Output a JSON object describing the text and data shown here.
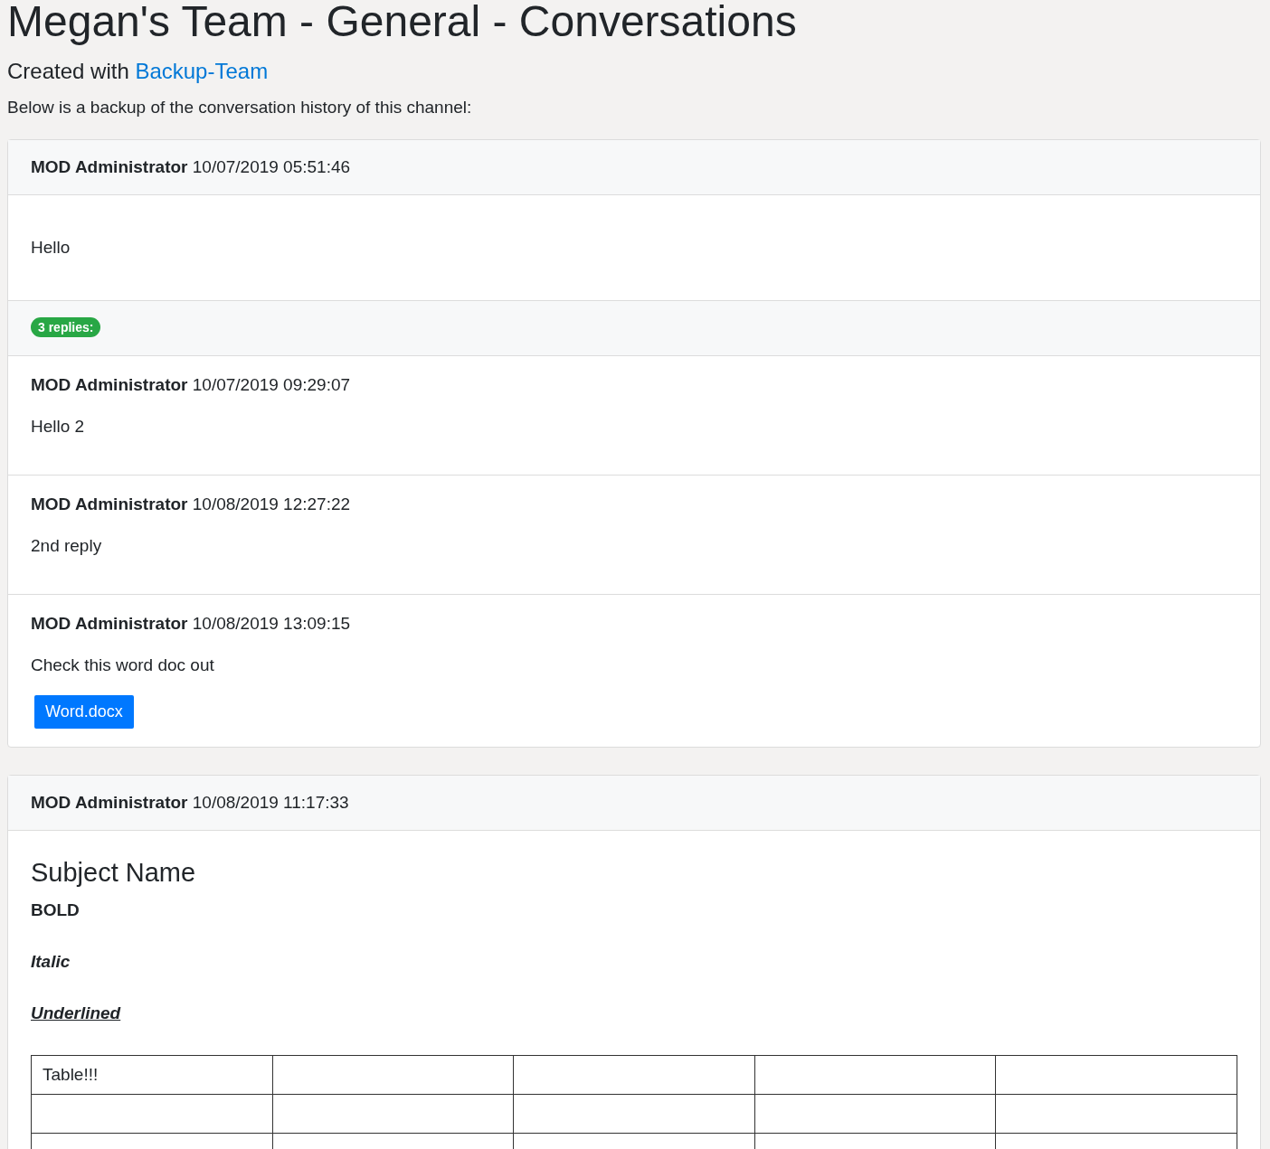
{
  "page": {
    "title": "Megan's Team - General - Conversations",
    "subtitle": "Created with",
    "subtitle_link": "Backup-Team",
    "intro": "Below is a backup of the conversation history of this channel:"
  },
  "threads": [
    {
      "author": "MOD Administrator",
      "time": "10/07/2019 05:51:46",
      "blocks": [
        {
          "kind": "text",
          "text": "Hello"
        }
      ],
      "replies_badge": "3 replies:",
      "replies": [
        {
          "author": "MOD Administrator",
          "time": "10/07/2019 09:29:07",
          "text": "Hello 2"
        },
        {
          "author": "MOD Administrator",
          "time": "10/08/2019 12:27:22",
          "text": "2nd reply"
        },
        {
          "author": "MOD Administrator",
          "time": "10/08/2019 13:09:15",
          "text": "Check this word doc out",
          "attachment": "Word.docx"
        }
      ]
    },
    {
      "author": "MOD Administrator",
      "time": "10/08/2019 11:17:33",
      "blocks": [
        {
          "kind": "heading",
          "text": "Subject Name"
        },
        {
          "kind": "bold",
          "text": "BOLD"
        },
        {
          "kind": "bold-italic",
          "text": "Italic"
        },
        {
          "kind": "bold-italic-underline",
          "text": "Underlined"
        },
        {
          "kind": "table",
          "rows": [
            [
              "Table!!!",
              null,
              null,
              null,
              null
            ],
            [
              null,
              null,
              null,
              null,
              null
            ],
            [
              null,
              null,
              null,
              null,
              null
            ]
          ]
        }
      ]
    }
  ]
}
